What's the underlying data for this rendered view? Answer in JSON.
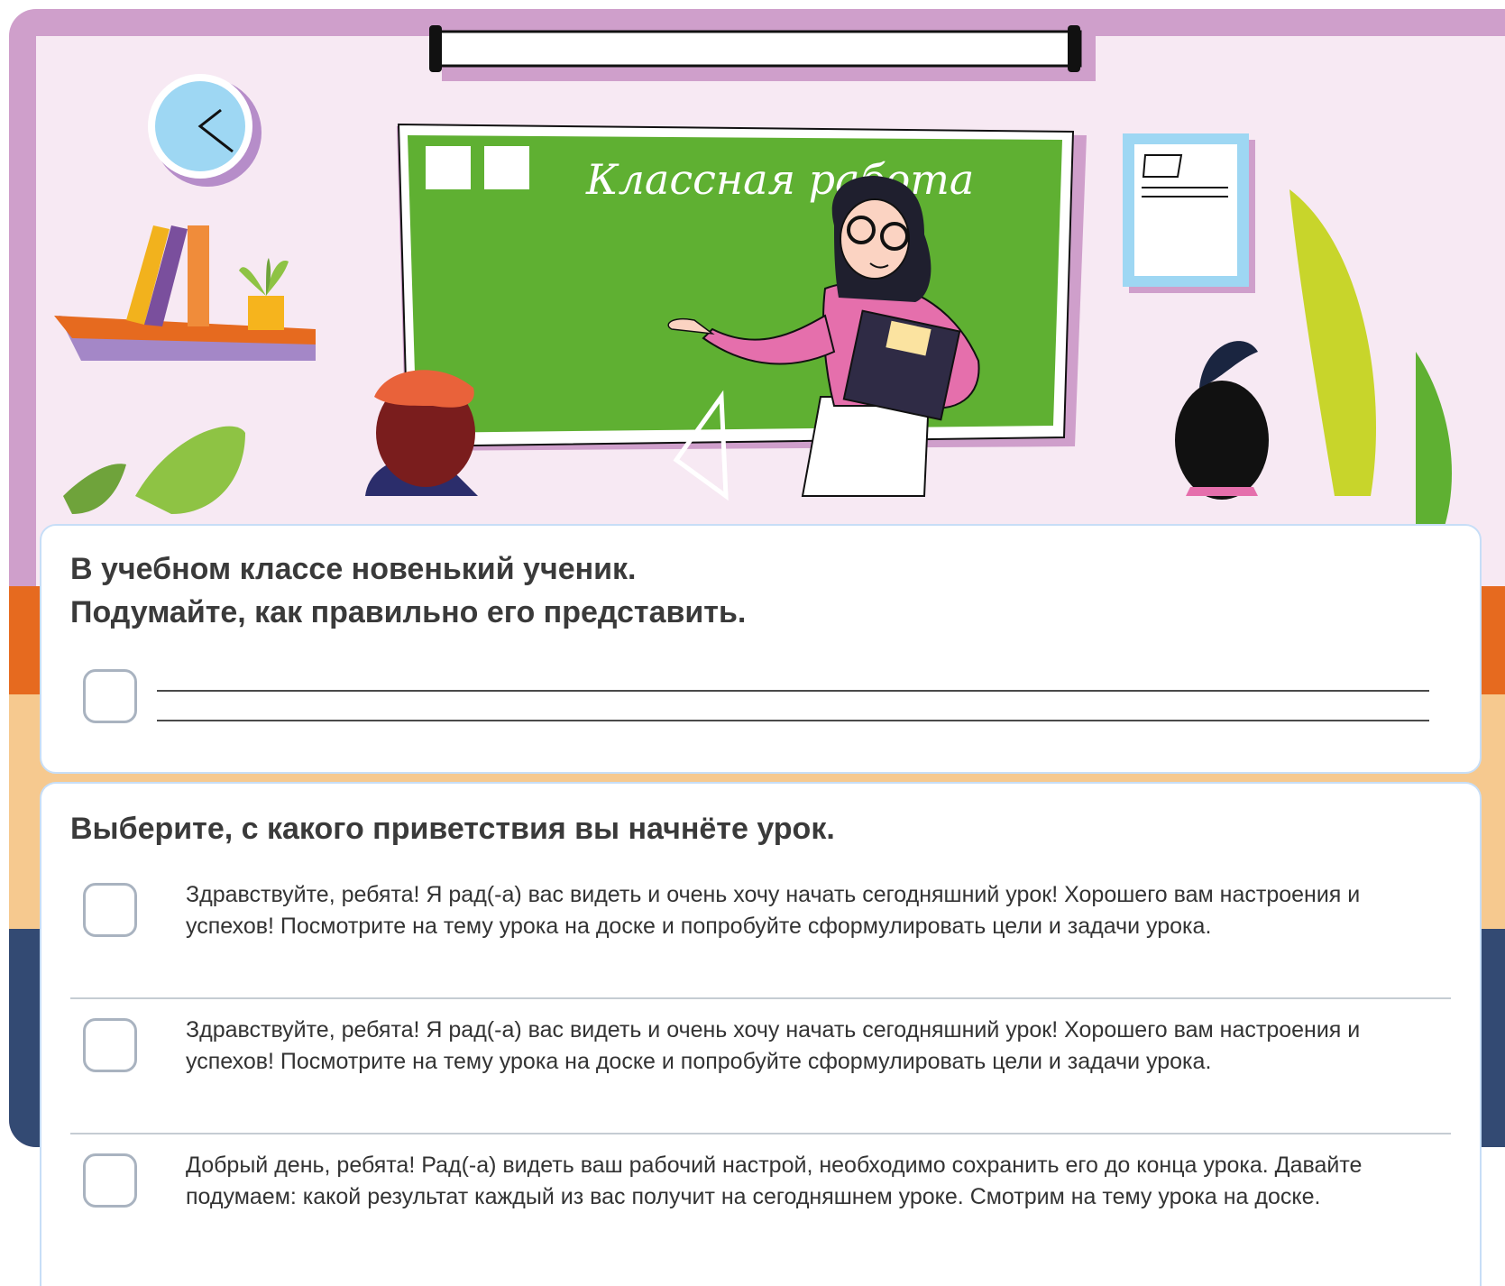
{
  "board_text": "Класcная работа",
  "question_1": {
    "title_line_1": "В учебном классе новенький ученик.",
    "title_line_2": "Подумайте, как правильно его представить.",
    "answer_line_1": "",
    "answer_line_2": ""
  },
  "question_2": {
    "title": "Выберите, с какого приветствия вы начнёте урок.",
    "options": [
      {
        "text": "Здравствуйте, ребята! Я рад(-а) вас видеть и очень хочу начать сегодняшний урок! Хорошего вам настроения и успехов! Посмотрите на тему урока на доске и попробуйте сформулировать цели и задачи урока.",
        "checked": false
      },
      {
        "text": "Здравствуйте, ребята! Я рад(-а) вас видеть и очень хочу начать сегодняшний урок! Хорошего вам настроения и успехов! Посмотрите на тему урока на доске и попробуйте сформулировать цели и задачи урока.",
        "checked": false
      },
      {
        "text": "Добрый день, ребята! Рад(-а) видеть ваш рабочий настрой, необходимо сохранить его до конца урока. Давайте подумаем: какой результат каждый из вас получит на сегодняшнем уроке. Смотрим на тему урока на доске.",
        "checked": false
      }
    ]
  },
  "colors": {
    "wall": "#f7e9f3",
    "wall_frame": "#cf9fcb",
    "board": "#5fb032",
    "teacher_shirt": "#e56fac",
    "panel_border": "#c7def7",
    "checkbox_border": "#a9b3c0",
    "text": "#3a3a3a"
  }
}
